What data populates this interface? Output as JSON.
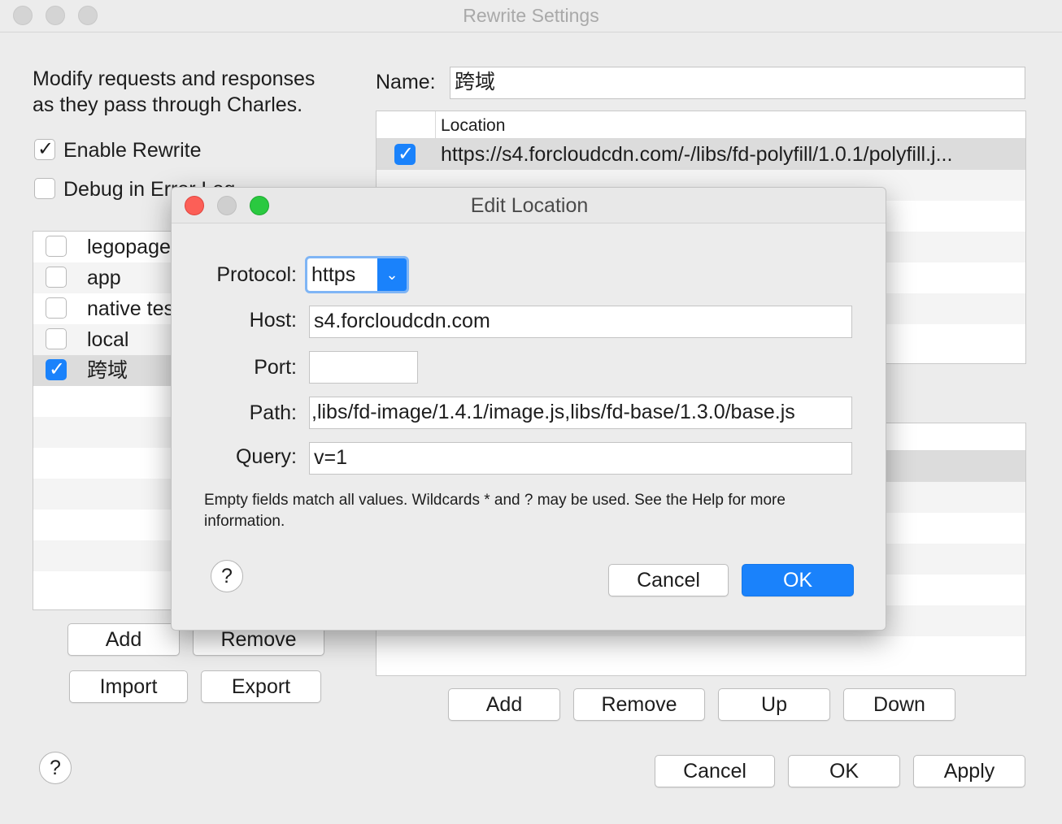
{
  "window": {
    "title": "Rewrite Settings"
  },
  "left": {
    "description_line1": "Modify requests and responses",
    "description_line2": "as they pass through Charles.",
    "enable_rewrite_label": "Enable Rewrite",
    "enable_rewrite_checked": true,
    "debug_label": "Debug in Error Log",
    "debug_checked": false,
    "sets": [
      {
        "label": "legopage",
        "checked": false
      },
      {
        "label": "app",
        "checked": false
      },
      {
        "label": "native test",
        "checked": false
      },
      {
        "label": "local",
        "checked": false
      },
      {
        "label": "跨域",
        "checked": true
      }
    ],
    "add_label": "Add",
    "remove_label": "Remove",
    "import_label": "Import",
    "export_label": "Export"
  },
  "right": {
    "name_label": "Name:",
    "name_value": "跨域",
    "location_header": "Location",
    "locations": [
      {
        "checked": true,
        "value": "https://s4.forcloudcdn.com/-/libs/fd-polyfill/1.0.1/polyfill.j..."
      }
    ],
    "add_label": "Add",
    "remove_label": "Remove",
    "up_label": "Up",
    "down_label": "Down"
  },
  "footer": {
    "help_label": "?",
    "cancel_label": "Cancel",
    "ok_label": "OK",
    "apply_label": "Apply"
  },
  "dialog": {
    "title": "Edit Location",
    "protocol_label": "Protocol:",
    "protocol_value": "https",
    "host_label": "Host:",
    "host_value": "s4.forcloudcdn.com",
    "port_label": "Port:",
    "port_value": "",
    "path_label": "Path:",
    "path_value": ",libs/fd-image/1.4.1/image.js,libs/fd-base/1.3.0/base.js",
    "query_label": "Query:",
    "query_value": "v=1",
    "note": "Empty fields match all values. Wildcards * and ? may be used. See the Help for more information.",
    "help_label": "?",
    "cancel_label": "Cancel",
    "ok_label": "OK"
  },
  "colors": {
    "accent": "#1a82fb",
    "traffic_red": "#fc5f57",
    "traffic_yellow_inactive": "#cfcfcf",
    "traffic_green": "#2ac940",
    "window_bg": "#ececec"
  }
}
